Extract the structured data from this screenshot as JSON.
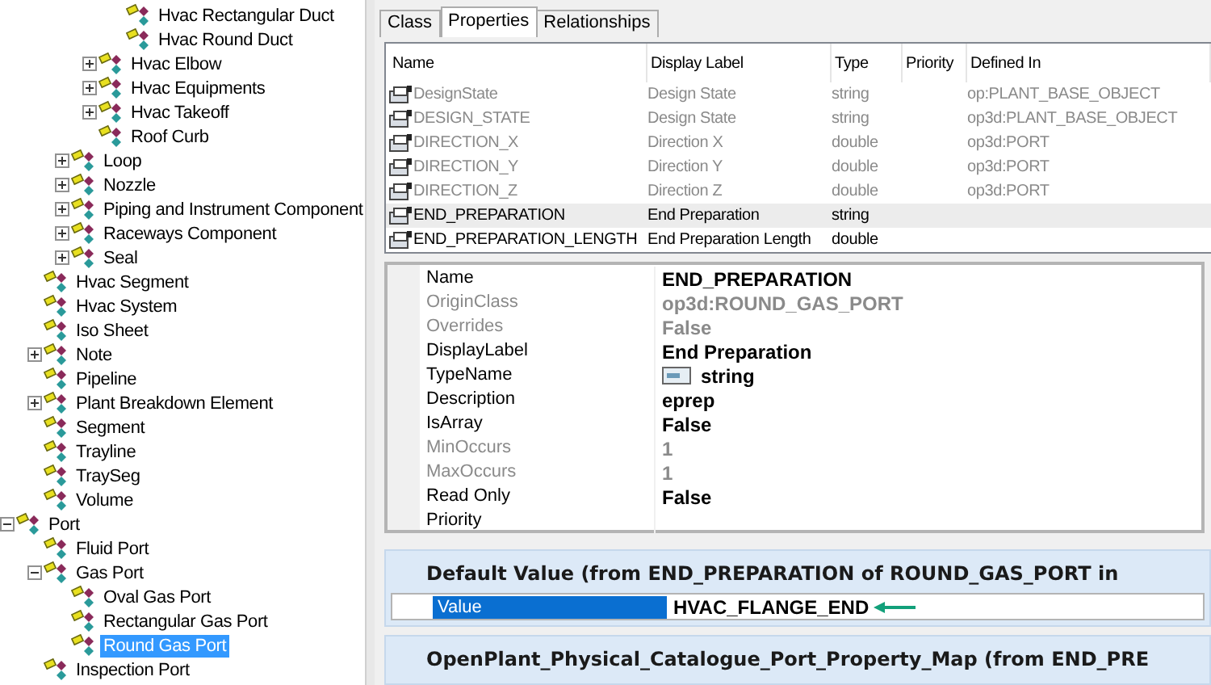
{
  "tree": {
    "items": [
      {
        "children": [
          {
            "children": [
              {
                "children": [
                  {
                    "children": [
                      {
                        "label": "Hvac Rectangular Duct",
                        "selected": false
                      },
                      {
                        "label": "Hvac Round Duct",
                        "selected": false
                      }
                    ]
                  },
                  {
                    "label": "Hvac Elbow",
                    "expanded": false,
                    "selected": false
                  },
                  {
                    "label": "Hvac Equipments",
                    "expanded": false,
                    "selected": false
                  },
                  {
                    "label": "Hvac Takeoff",
                    "expanded": false,
                    "selected": false
                  },
                  {
                    "label": "Roof Curb",
                    "selected": false
                  }
                ]
              },
              {
                "label": "Loop",
                "expanded": false,
                "selected": false
              },
              {
                "label": "Nozzle",
                "expanded": false,
                "selected": false
              },
              {
                "label": "Piping and Instrument Component",
                "expanded": false,
                "selected": false
              },
              {
                "label": "Raceways Component",
                "expanded": false,
                "selected": false
              },
              {
                "label": "Seal",
                "expanded": false,
                "selected": false
              }
            ]
          },
          {
            "label": "Hvac Segment",
            "selected": false
          },
          {
            "label": "Hvac System",
            "selected": false
          },
          {
            "label": "Iso Sheet",
            "selected": false
          },
          {
            "label": "Note",
            "expanded": false,
            "selected": false
          },
          {
            "label": "Pipeline",
            "selected": false
          },
          {
            "label": "Plant Breakdown Element",
            "expanded": false,
            "selected": false
          },
          {
            "label": "Segment",
            "selected": false
          },
          {
            "label": "Trayline",
            "selected": false
          },
          {
            "label": "TraySeg",
            "selected": false
          },
          {
            "label": "Volume",
            "selected": false
          }
        ]
      },
      {
        "label": "Port",
        "expanded": true,
        "selected": false,
        "children": [
          {
            "label": "Fluid Port",
            "selected": false
          },
          {
            "label": "Gas Port",
            "expanded": true,
            "selected": false,
            "children": [
              {
                "label": "Oval Gas Port",
                "selected": false
              },
              {
                "label": "Rectangular Gas Port",
                "selected": false
              },
              {
                "label": "Round Gas Port",
                "selected": true
              }
            ]
          },
          {
            "label": "Inspection Port",
            "selected": false
          }
        ]
      }
    ]
  },
  "tabs": [
    {
      "label": "Class",
      "selected": false
    },
    {
      "label": "Properties",
      "selected": true
    },
    {
      "label": "Relationships",
      "selected": false
    }
  ],
  "properties": {
    "columns": [
      "Name",
      "Display Label",
      "Type",
      "Priority",
      "Defined In"
    ],
    "rows": [
      {
        "name": "DesignState",
        "display_label": "Design State",
        "type": "string",
        "defined_in": "op:PLANT_BASE_OBJECT",
        "inherited": true,
        "selected": false
      },
      {
        "name": "DESIGN_STATE",
        "display_label": "Design State",
        "type": "string",
        "defined_in": "op3d:PLANT_BASE_OBJECT",
        "inherited": true,
        "selected": false
      },
      {
        "name": "DIRECTION_X",
        "display_label": "Direction X",
        "type": "double",
        "defined_in": "op3d:PORT",
        "inherited": true,
        "selected": false
      },
      {
        "name": "DIRECTION_Y",
        "display_label": "Direction Y",
        "type": "double",
        "defined_in": "op3d:PORT",
        "inherited": true,
        "selected": false
      },
      {
        "name": "DIRECTION_Z",
        "display_label": "Direction Z",
        "type": "double",
        "defined_in": "op3d:PORT",
        "inherited": true,
        "selected": false
      },
      {
        "name": "END_PREPARATION",
        "display_label": "End Preparation",
        "type": "string",
        "inherited": false,
        "selected": true
      },
      {
        "name": "END_PREPARATION_LENGTH",
        "display_label": "End Preparation Length",
        "type": "double",
        "inherited": false,
        "selected": false
      }
    ]
  },
  "property_grid": [
    {
      "label": "Name",
      "value": "END_PREPARATION",
      "disabled": false
    },
    {
      "label": "OriginClass",
      "value": "op3d:ROUND_GAS_PORT",
      "disabled": true
    },
    {
      "label": "Overrides",
      "value": "False",
      "disabled": true
    },
    {
      "label": "DisplayLabel",
      "value": "End Preparation",
      "disabled": false
    },
    {
      "label": "TypeName",
      "value": "string",
      "disabled": false,
      "kind": "type"
    },
    {
      "label": "Description",
      "value": "eprep",
      "disabled": false
    },
    {
      "label": "IsArray",
      "value": "False",
      "disabled": false
    },
    {
      "label": "MinOccurs",
      "value": "1",
      "disabled": true
    },
    {
      "label": "MaxOccurs",
      "value": "1",
      "disabled": true
    },
    {
      "label": "Read Only",
      "value": "False",
      "disabled": false
    },
    {
      "label": "Priority",
      "disabled": false
    }
  ],
  "default_value": {
    "title": "Default Value (from END_PREPARATION of ROUND_GAS_PORT in",
    "label": "Value",
    "value": "HVAC_FLANGE_END"
  },
  "property_map": {
    "title": "OpenPlant_Physical_Catalogue_Port_Property_Map (from END_PRE"
  }
}
